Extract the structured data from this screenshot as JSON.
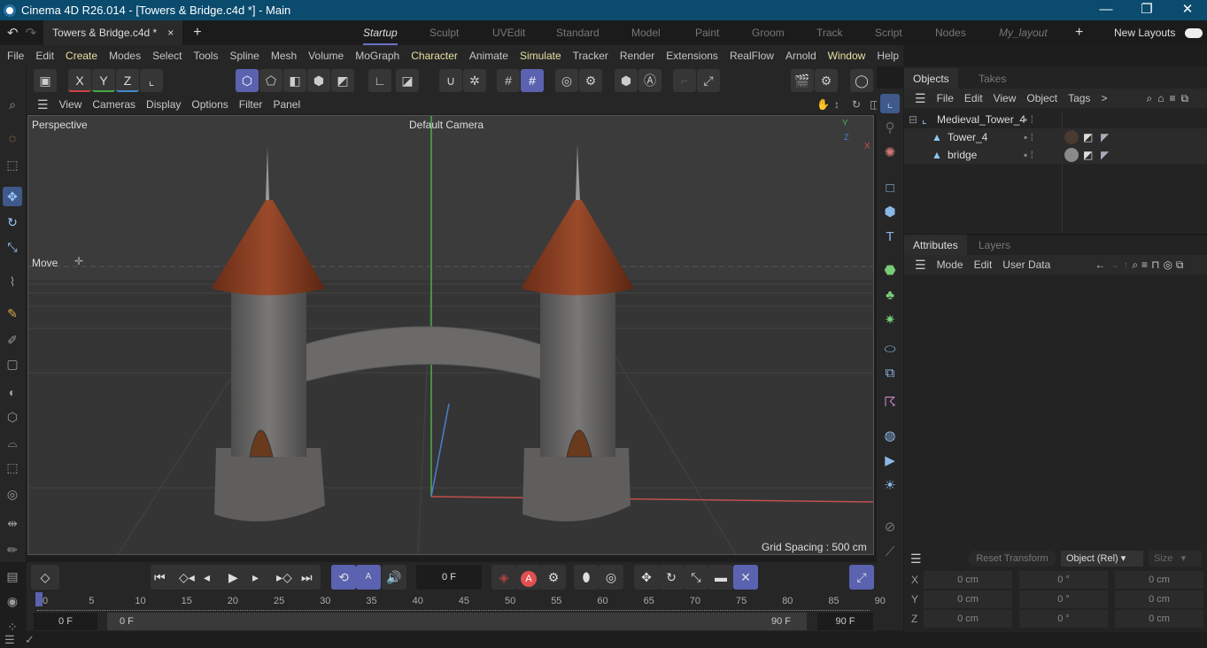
{
  "window": {
    "title": "Cinema 4D R26.014 - [Towers & Bridge.c4d *] - Main",
    "minimize": "—",
    "restore": "❐",
    "close": "✕"
  },
  "file_tab": {
    "label": "Towers & Bridge.c4d *",
    "close": "×",
    "add": "+"
  },
  "layouts": {
    "items": [
      "Startup",
      "Sculpt",
      "UVEdit",
      "Standard",
      "Model",
      "Paint",
      "Groom",
      "Track",
      "Script",
      "Nodes",
      "My_layout"
    ],
    "active": "Startup",
    "add": "+",
    "new_layouts": "New Layouts"
  },
  "menu": [
    "File",
    "Edit",
    "Create",
    "Modes",
    "Select",
    "Tools",
    "Spline",
    "Mesh",
    "Volume",
    "MoGraph",
    "Character",
    "Animate",
    "Simulate",
    "Tracker",
    "Render",
    "Extensions",
    "RealFlow",
    "Arnold",
    "Window",
    "Help"
  ],
  "toolbar": {
    "x": "X",
    "y": "Y",
    "z": "Z"
  },
  "viewport": {
    "menu": [
      "View",
      "Cameras",
      "Display",
      "Options",
      "Filter",
      "Panel"
    ],
    "label": "Perspective",
    "camera": "Default Camera",
    "tool": "Move",
    "grid_spacing": "Grid Spacing : 500 cm",
    "axis_y": "Y",
    "axis_x": "X",
    "axis_z": "Z"
  },
  "objects": {
    "tabs": [
      "Objects",
      "Takes"
    ],
    "menu": [
      "File",
      "Edit",
      "View",
      "Object",
      "Tags"
    ],
    "more": ">",
    "items": [
      {
        "name": "Medieval_Tower_4"
      },
      {
        "name": "Tower_4"
      },
      {
        "name": "bridge"
      }
    ]
  },
  "attributes": {
    "tabs": [
      "Attributes",
      "Layers"
    ],
    "menu": [
      "Mode",
      "Edit",
      "User Data"
    ]
  },
  "coordinates": {
    "reset": "Reset Transform",
    "mode": "Object (Rel)",
    "size": "Size",
    "rows": [
      {
        "axis": "X",
        "pos": "0 cm",
        "rot": "0 °",
        "scale": "0 cm"
      },
      {
        "axis": "Y",
        "pos": "0 cm",
        "rot": "0 °",
        "scale": "0 cm"
      },
      {
        "axis": "Z",
        "pos": "0 cm",
        "rot": "0 °",
        "scale": "0 cm"
      }
    ]
  },
  "timeline": {
    "current_frame": "0 F",
    "ticks": [
      "0",
      "5",
      "10",
      "15",
      "20",
      "25",
      "30",
      "35",
      "40",
      "45",
      "50",
      "55",
      "60",
      "65",
      "70",
      "75",
      "80",
      "85",
      "90"
    ],
    "start": "0 F",
    "range_start": "0 F",
    "range_end": "90 F",
    "end": "90 F"
  },
  "colors": {
    "accent": "#5b62b0",
    "titlebar": "#0a4b6e",
    "x_axis": "#d9534f",
    "y_axis": "#4caf50",
    "z_axis": "#4a7fd0"
  }
}
